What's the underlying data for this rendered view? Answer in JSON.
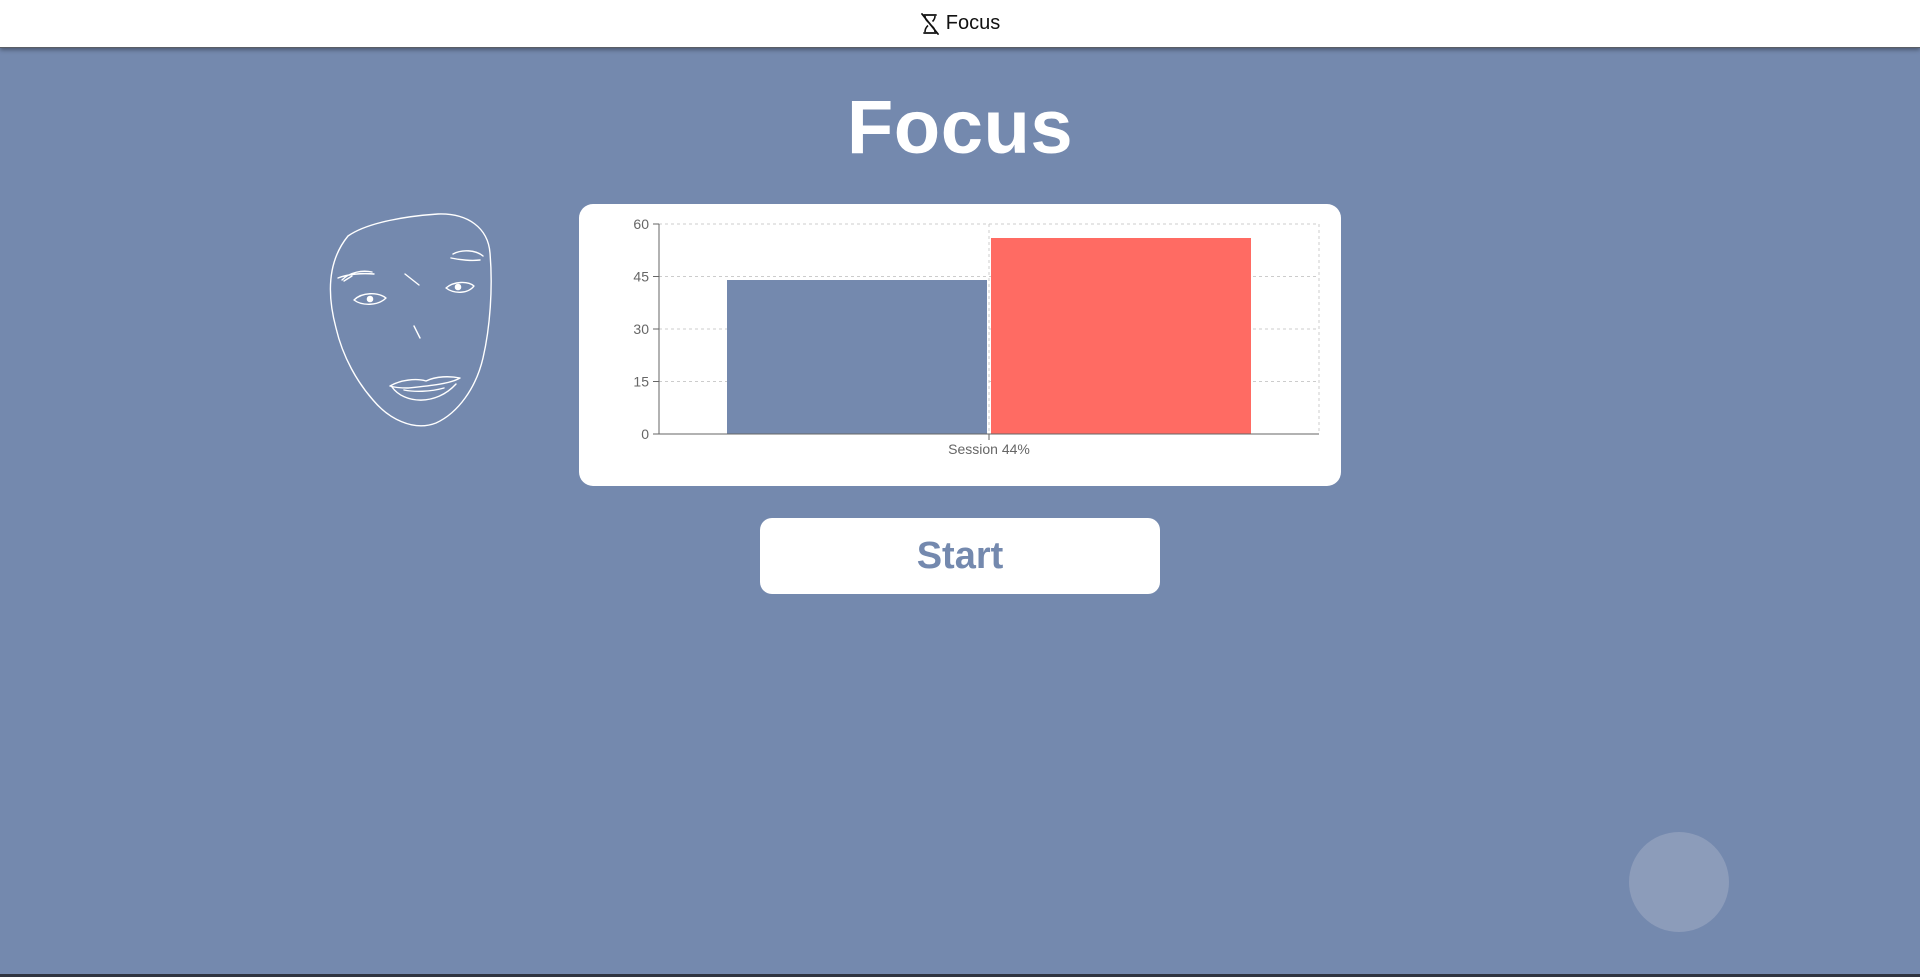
{
  "header": {
    "app_name": "Focus",
    "icon": "hourglass-off-icon"
  },
  "main": {
    "title": "Focus",
    "start_label": "Start",
    "face_icon": "face-sketch-icon",
    "floating_button_icon": "circle-button"
  },
  "colors": {
    "background": "#7489ae",
    "accent_red": "#ff6b63",
    "bar_blue": "#7489ae",
    "card": "#ffffff"
  },
  "chart_data": {
    "type": "bar",
    "categories": [
      "Session 44%"
    ],
    "series": [
      {
        "values": [
          44
        ],
        "color": "#7489ae"
      },
      {
        "values": [
          56
        ],
        "color": "#ff6b63"
      }
    ],
    "ylim": [
      0,
      60
    ],
    "yticks": [
      0,
      15,
      30,
      45,
      60
    ],
    "grid": true,
    "title": "",
    "xlabel": "",
    "ylabel": ""
  }
}
